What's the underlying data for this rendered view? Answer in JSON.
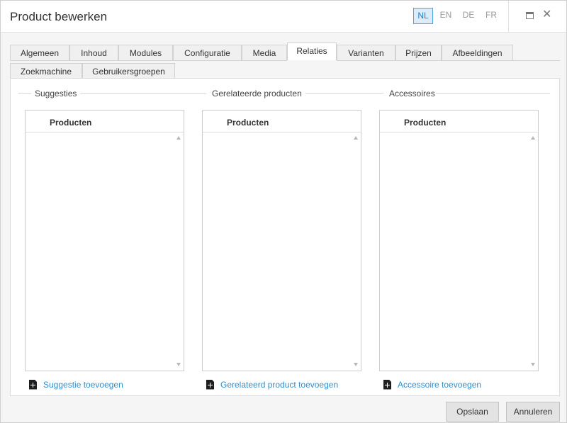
{
  "window": {
    "title": "Product bewerken"
  },
  "languages": [
    "NL",
    "EN",
    "DE",
    "FR"
  ],
  "active_language": "NL",
  "window_controls": {
    "maximize_icon": "maximize-icon",
    "close_icon": "close-icon",
    "close_glyph": "✕"
  },
  "tabs": {
    "row1": [
      "Algemeen",
      "Inhoud",
      "Modules",
      "Configuratie",
      "Media",
      "Relaties",
      "Varianten",
      "Prijzen",
      "Afbeeldingen"
    ],
    "row2": [
      "Zoekmachine",
      "Gebruikersgroepen"
    ],
    "active": "Relaties"
  },
  "sections": [
    {
      "title": "Suggesties",
      "column_header": "Producten",
      "add_link": "Suggestie toevoegen"
    },
    {
      "title": "Gerelateerde producten",
      "column_header": "Producten",
      "add_link": "Gerelateerd product toevoegen"
    },
    {
      "title": "Accessoires",
      "column_header": "Producten",
      "add_link": "Accessoire toevoegen"
    }
  ],
  "footer": {
    "save_label": "Opslaan",
    "cancel_label": "Annuleren"
  },
  "colors": {
    "accent": "#2e8fcf",
    "active_lang_bg": "#dcecf9",
    "active_lang_border": "#4aa3df"
  }
}
